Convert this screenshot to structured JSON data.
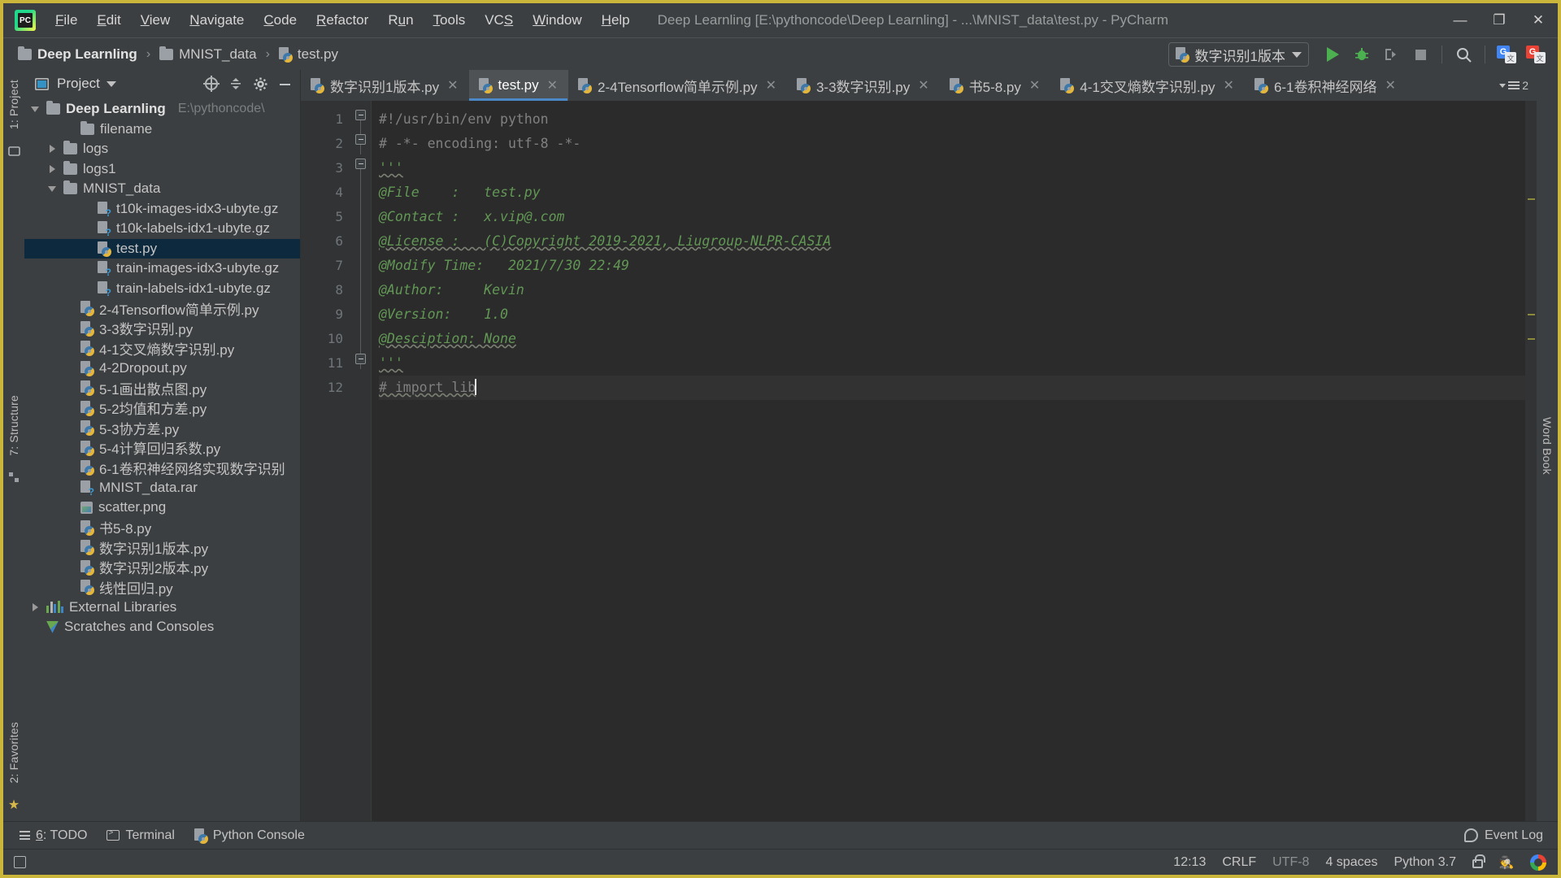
{
  "window": {
    "app_logo": "pycharm-logo",
    "title": "Deep Learnling [E:\\pythoncode\\Deep Learnling] - ...\\MNIST_data\\test.py - PyCharm",
    "minimize": "—",
    "maximize": "❐",
    "close": "✕"
  },
  "menu": [
    {
      "label": "File",
      "mnemonic": "F"
    },
    {
      "label": "Edit",
      "mnemonic": "E"
    },
    {
      "label": "View",
      "mnemonic": "V"
    },
    {
      "label": "Navigate",
      "mnemonic": "N"
    },
    {
      "label": "Code",
      "mnemonic": "C"
    },
    {
      "label": "Refactor",
      "mnemonic": "R"
    },
    {
      "label": "Run",
      "mnemonic": "u"
    },
    {
      "label": "Tools",
      "mnemonic": "T"
    },
    {
      "label": "VCS",
      "mnemonic": "S"
    },
    {
      "label": "Window",
      "mnemonic": "W"
    },
    {
      "label": "Help",
      "mnemonic": "H"
    }
  ],
  "breadcrumb": [
    {
      "label": "Deep Learnling",
      "icon": "folder-icon"
    },
    {
      "label": "MNIST_data",
      "icon": "folder-icon"
    },
    {
      "label": "test.py",
      "icon": "python-file-icon"
    }
  ],
  "breadcrumb_separator": "›",
  "toolbar": {
    "run_config": "数字识别1版本",
    "run_config_icon": "python-icon",
    "buttons": [
      {
        "name": "run-button",
        "icon": "play-icon"
      },
      {
        "name": "debug-button",
        "icon": "bug-icon"
      },
      {
        "name": "run-coverage-button",
        "icon": "coverage-icon"
      },
      {
        "name": "stop-button",
        "icon": "stop-icon"
      },
      {
        "name": "search-everywhere-button",
        "icon": "search-icon"
      },
      {
        "name": "google-translate-blue-button",
        "icon": "translate-blue-icon"
      },
      {
        "name": "google-translate-red-button",
        "icon": "translate-red-icon"
      }
    ]
  },
  "left_rail": {
    "top": "1: Project",
    "middle": "7: Structure",
    "bottom": "2: Favorites"
  },
  "right_rail": {
    "label": "Word Book"
  },
  "project_panel": {
    "title": "Project",
    "header_icons": [
      "chevron-down-icon",
      "locate-icon",
      "collapse-all-icon",
      "gear-icon",
      "hide-icon"
    ],
    "tree": [
      {
        "depth": 0,
        "label": "Deep Learnling",
        "hint": "E:\\pythoncode\\",
        "icon": "folder-icon",
        "arrow": "open",
        "bold": true
      },
      {
        "depth": 2,
        "label": "filename",
        "icon": "folder-icon",
        "arrow": "none"
      },
      {
        "depth": 1,
        "label": "logs",
        "icon": "folder-icon",
        "arrow": "closed"
      },
      {
        "depth": 1,
        "label": "logs1",
        "icon": "folder-icon",
        "arrow": "closed"
      },
      {
        "depth": 1,
        "label": "MNIST_data",
        "icon": "folder-icon",
        "arrow": "open"
      },
      {
        "depth": 3,
        "label": "t10k-images-idx3-ubyte.gz",
        "icon": "unknown-file-icon",
        "arrow": "none"
      },
      {
        "depth": 3,
        "label": "t10k-labels-idx1-ubyte.gz",
        "icon": "unknown-file-icon",
        "arrow": "none"
      },
      {
        "depth": 3,
        "label": "test.py",
        "icon": "python-file-icon",
        "arrow": "none",
        "selected": true
      },
      {
        "depth": 3,
        "label": "train-images-idx3-ubyte.gz",
        "icon": "unknown-file-icon",
        "arrow": "none"
      },
      {
        "depth": 3,
        "label": "train-labels-idx1-ubyte.gz",
        "icon": "unknown-file-icon",
        "arrow": "none"
      },
      {
        "depth": 2,
        "label": "2-4Tensorflow简单示例.py",
        "icon": "python-file-icon",
        "arrow": "none"
      },
      {
        "depth": 2,
        "label": "3-3数字识别.py",
        "icon": "python-file-icon",
        "arrow": "none"
      },
      {
        "depth": 2,
        "label": "4-1交叉熵数字识别.py",
        "icon": "python-file-icon",
        "arrow": "none"
      },
      {
        "depth": 2,
        "label": "4-2Dropout.py",
        "icon": "python-file-icon",
        "arrow": "none"
      },
      {
        "depth": 2,
        "label": "5-1画出散点图.py",
        "icon": "python-file-icon",
        "arrow": "none"
      },
      {
        "depth": 2,
        "label": "5-2均值和方差.py",
        "icon": "python-file-icon",
        "arrow": "none"
      },
      {
        "depth": 2,
        "label": "5-3协方差.py",
        "icon": "python-file-icon",
        "arrow": "none"
      },
      {
        "depth": 2,
        "label": "5-4计算回归系数.py",
        "icon": "python-file-icon",
        "arrow": "none"
      },
      {
        "depth": 2,
        "label": "6-1卷积神经网络实现数字识别",
        "icon": "python-file-icon",
        "arrow": "none"
      },
      {
        "depth": 2,
        "label": "MNIST_data.rar",
        "icon": "unknown-file-icon",
        "arrow": "none"
      },
      {
        "depth": 2,
        "label": "scatter.png",
        "icon": "image-file-icon",
        "arrow": "none"
      },
      {
        "depth": 2,
        "label": "书5-8.py",
        "icon": "python-file-icon",
        "arrow": "none"
      },
      {
        "depth": 2,
        "label": "数字识别1版本.py",
        "icon": "python-file-icon",
        "arrow": "none"
      },
      {
        "depth": 2,
        "label": "数字识别2版本.py",
        "icon": "python-file-icon",
        "arrow": "none"
      },
      {
        "depth": 2,
        "label": "线性回归.py",
        "icon": "python-file-icon",
        "arrow": "none"
      },
      {
        "depth": 0,
        "label": "External Libraries",
        "icon": "library-icon",
        "arrow": "closed"
      },
      {
        "depth": 0,
        "label": "Scratches and Consoles",
        "icon": "scratches-icon",
        "arrow": "none"
      }
    ]
  },
  "editor": {
    "tabs": [
      {
        "label": "数字识别1版本.py",
        "active": false,
        "closable": true
      },
      {
        "label": "test.py",
        "active": true,
        "closable": true
      },
      {
        "label": "2-4Tensorflow简单示例.py",
        "active": false,
        "closable": true
      },
      {
        "label": "3-3数字识别.py",
        "active": false,
        "closable": true
      },
      {
        "label": "书5-8.py",
        "active": false,
        "closable": true
      },
      {
        "label": "4-1交叉熵数字识别.py",
        "active": false,
        "closable": true
      },
      {
        "label": "6-1卷积神经网络",
        "active": false,
        "closable": true
      }
    ],
    "tab_close_glyph": "✕",
    "hidden_tabs_count": "2",
    "lines": [
      {
        "n": "1",
        "text": "#!/usr/bin/env python",
        "style": "comment",
        "fold": "start"
      },
      {
        "n": "2",
        "text": "# -*- encoding: utf-8 -*-",
        "style": "comment",
        "fold": "end"
      },
      {
        "n": "3",
        "text": "'''",
        "style": "doc",
        "fold": "start"
      },
      {
        "n": "4",
        "text": "@File    :   test.py",
        "style": "doc"
      },
      {
        "n": "5",
        "text": "@Contact :   x.vip@.com",
        "style": "doc"
      },
      {
        "n": "6",
        "text": "@License :   (C)Copyright 2019-2021, Liugroup-NLPR-CASIA",
        "style": "doc"
      },
      {
        "n": "7",
        "text": "@Modify Time:   2021/7/30 22:49",
        "style": "doc"
      },
      {
        "n": "8",
        "text": "@Author:     Kevin",
        "style": "doc"
      },
      {
        "n": "9",
        "text": "@Version:    1.0",
        "style": "doc"
      },
      {
        "n": "10",
        "text": "@Desciption: None",
        "style": "doc"
      },
      {
        "n": "11",
        "text": "'''",
        "style": "doc",
        "fold": "end"
      },
      {
        "n": "12",
        "text": "# import lib",
        "style": "comment",
        "current": true,
        "caret": true
      }
    ]
  },
  "bottom_bar": {
    "items": [
      {
        "label": "6: TODO",
        "icon": "todo-icon",
        "mnemonic": "6"
      },
      {
        "label": "Terminal",
        "icon": "terminal-icon"
      },
      {
        "label": "Python Console",
        "icon": "python-console-icon"
      }
    ],
    "event_log": "Event Log",
    "event_log_icon": "event-log-icon"
  },
  "status_bar": {
    "left_icon": "toggle-toolbar-icon",
    "cursor_position": "12:13",
    "line_separator": "CRLF",
    "encoding": "UTF-8",
    "indent": "4 spaces",
    "interpreter": "Python 3.7",
    "lock_icon": "unlocked-icon",
    "inspector_icon": "hector-icon",
    "google_icon": "google-icon"
  },
  "colors": {
    "window_bg": "#3c3f41",
    "editor_bg": "#2b2b2b",
    "gutter_bg": "#313335",
    "accent_tab": "#4a88c7",
    "selection": "#0d293e",
    "comment": "#808080",
    "docstring": "#629755",
    "run_green": "#4caf50",
    "border_yellow": "#c9b63a"
  }
}
